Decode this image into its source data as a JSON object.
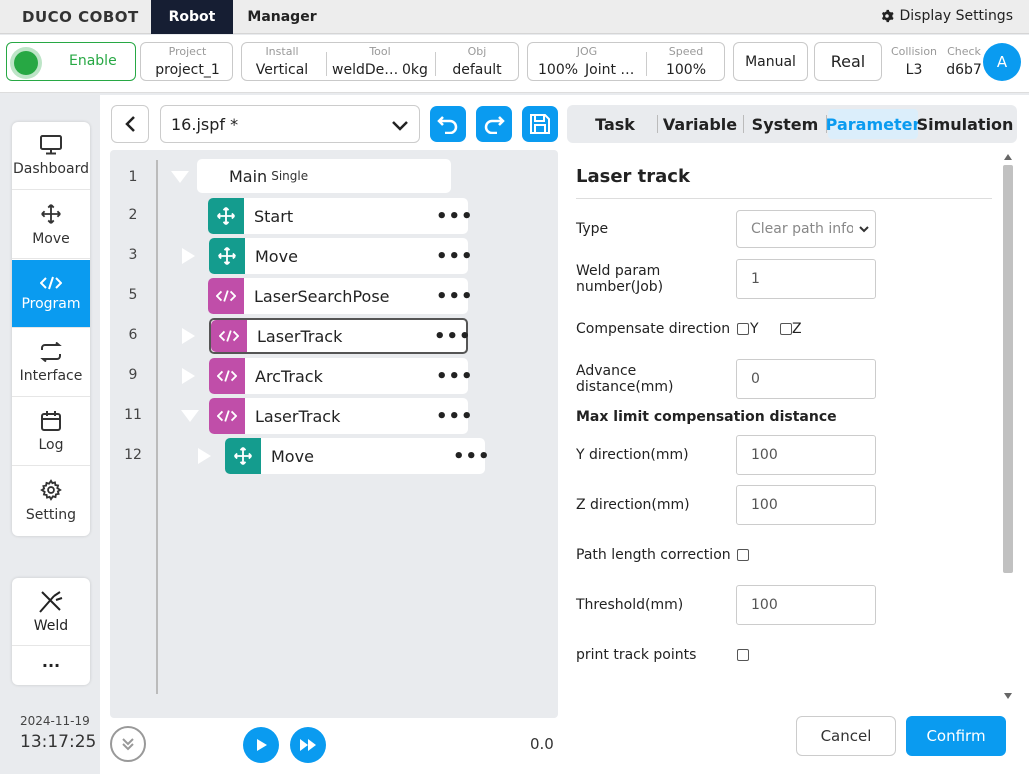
{
  "topbar": {
    "logo": "DUCO COBOT",
    "tab_robot": "Robot",
    "tab_manager": "Manager",
    "display_settings": "Display Settings"
  },
  "status": {
    "enable": "Enable",
    "project_label": "Project",
    "project_value": "project_1",
    "install_label": "Install",
    "install_value": "Vertical",
    "tool_label": "Tool",
    "tool_value": "weldDe…",
    "tool_weight": "0kg",
    "obj_label": "Obj",
    "obj_value": "default",
    "jog_label": "JOG",
    "jog_value": "100%",
    "jog_mode": "Joint …",
    "speed_label": "Speed",
    "speed_value": "100%",
    "manual": "Manual",
    "real": "Real",
    "collision_label": "Collision",
    "collision_value": "L3",
    "check_label": "Check",
    "check_value": "d6b7",
    "avatar": "A"
  },
  "sidebar": {
    "items": [
      {
        "label": "Dashboard",
        "icon": "monitor-icon"
      },
      {
        "label": "Move",
        "icon": "move-arrows-icon"
      },
      {
        "label": "Program",
        "icon": "code-icon"
      },
      {
        "label": "Interface",
        "icon": "swap-icon"
      },
      {
        "label": "Log",
        "icon": "calendar-icon"
      },
      {
        "label": "Setting",
        "icon": "gear-icon"
      }
    ],
    "weld_label": "Weld",
    "more": "···"
  },
  "program": {
    "file_name": "16.jspf *",
    "tree": [
      {
        "line": "1",
        "label": "Main",
        "sub": "Single"
      },
      {
        "line": "2",
        "label": "Start"
      },
      {
        "line": "3",
        "label": "Move"
      },
      {
        "line": "5",
        "label": "LaserSearchPose"
      },
      {
        "line": "6",
        "label": "LaserTrack"
      },
      {
        "line": "9",
        "label": "ArcTrack"
      },
      {
        "line": "11",
        "label": "LaserTrack"
      },
      {
        "line": "12",
        "label": "Move"
      }
    ],
    "dots": "•••",
    "speed_value": "0.0"
  },
  "tabs": {
    "task": "Task",
    "variable": "Variable",
    "system": "System",
    "parameter": "Parameter",
    "simulation": "Simulation"
  },
  "params": {
    "title": "Laser track",
    "type_label": "Type",
    "type_value": "Clear path info",
    "weld_param_label": "Weld param number(Job)",
    "weld_param_value": "1",
    "compensate_label": "Compensate direction",
    "comp_y": "Y",
    "comp_z": "Z",
    "advance_label": "Advance distance(mm)",
    "advance_value": "0",
    "max_limit_heading": "Max limit compensation distance",
    "y_dir_label": "Y direction(mm)",
    "y_dir_value": "100",
    "z_dir_label": "Z direction(mm)",
    "z_dir_value": "100",
    "path_corr_label": "Path length correction",
    "threshold_label": "Threshold(mm)",
    "threshold_value": "100",
    "print_label": "print track points"
  },
  "buttons": {
    "cancel": "Cancel",
    "confirm": "Confirm"
  },
  "footer": {
    "date": "2024-11-19",
    "time": "13:17:25"
  },
  "colors": {
    "accent": "#0a9bf0",
    "nav_dark": "#161e33",
    "teal": "#149c8e",
    "magenta": "#c04ea9",
    "enable_green": "#27a844"
  }
}
